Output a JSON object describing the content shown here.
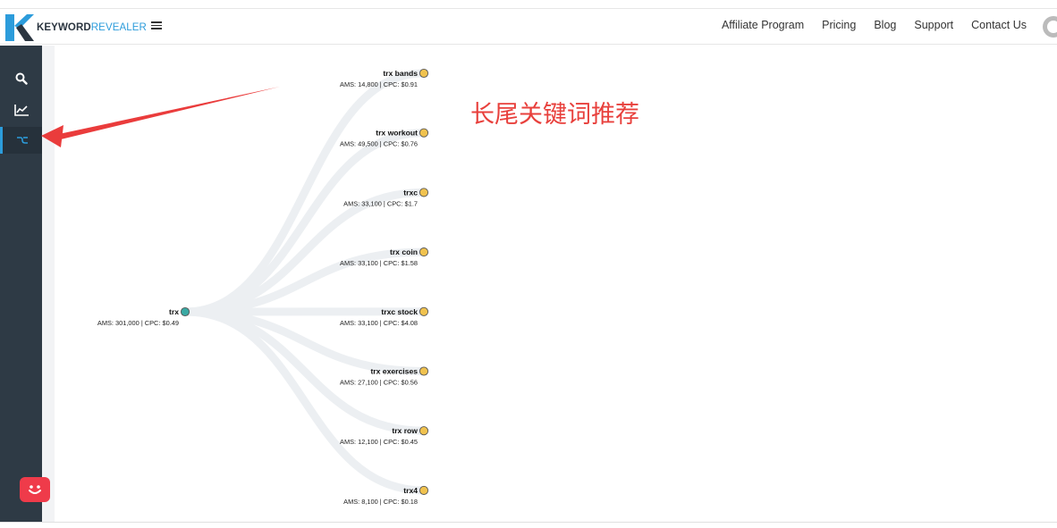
{
  "header": {
    "logo": {
      "bold": "KEYWORD",
      "light": "REVEALER"
    },
    "nav": [
      "Affiliate Program",
      "Pricing",
      "Blog",
      "Support",
      "Contact Us"
    ]
  },
  "sidebar": {
    "items": [
      {
        "icon": "search-icon",
        "active": false
      },
      {
        "icon": "chart-line-icon",
        "active": false
      },
      {
        "icon": "tree-icon",
        "active": true
      }
    ]
  },
  "annotation": "长尾关键词推荐",
  "colors": {
    "sidebar": "#2e3a45",
    "accent": "#2c9cdb",
    "rootNode": "#3aa9a3",
    "childNode": "#f0c24f",
    "link": "#eceff2",
    "arrow": "#ea3c3c",
    "annotation": "#e8403c"
  },
  "tree": {
    "root": {
      "name": "trx",
      "meta": "AMS: 301,000 | CPC: $0.49"
    },
    "children": [
      {
        "name": "trx bands",
        "meta": "AMS: 14,800 | CPC: $0.91"
      },
      {
        "name": "trx workout",
        "meta": "AMS: 49,500 | CPC: $0.76"
      },
      {
        "name": "trxc",
        "meta": "AMS: 33,100 | CPC: $1.7"
      },
      {
        "name": "trx coin",
        "meta": "AMS: 33,100 | CPC: $1.58"
      },
      {
        "name": "trxc stock",
        "meta": "AMS: 33,100 | CPC: $4.08"
      },
      {
        "name": "trx exercises",
        "meta": "AMS: 27,100 | CPC: $0.56"
      },
      {
        "name": "trx row",
        "meta": "AMS: 12,100 | CPC: $0.45"
      },
      {
        "name": "trx4",
        "meta": "AMS: 8,100 | CPC: $0.18"
      }
    ]
  }
}
